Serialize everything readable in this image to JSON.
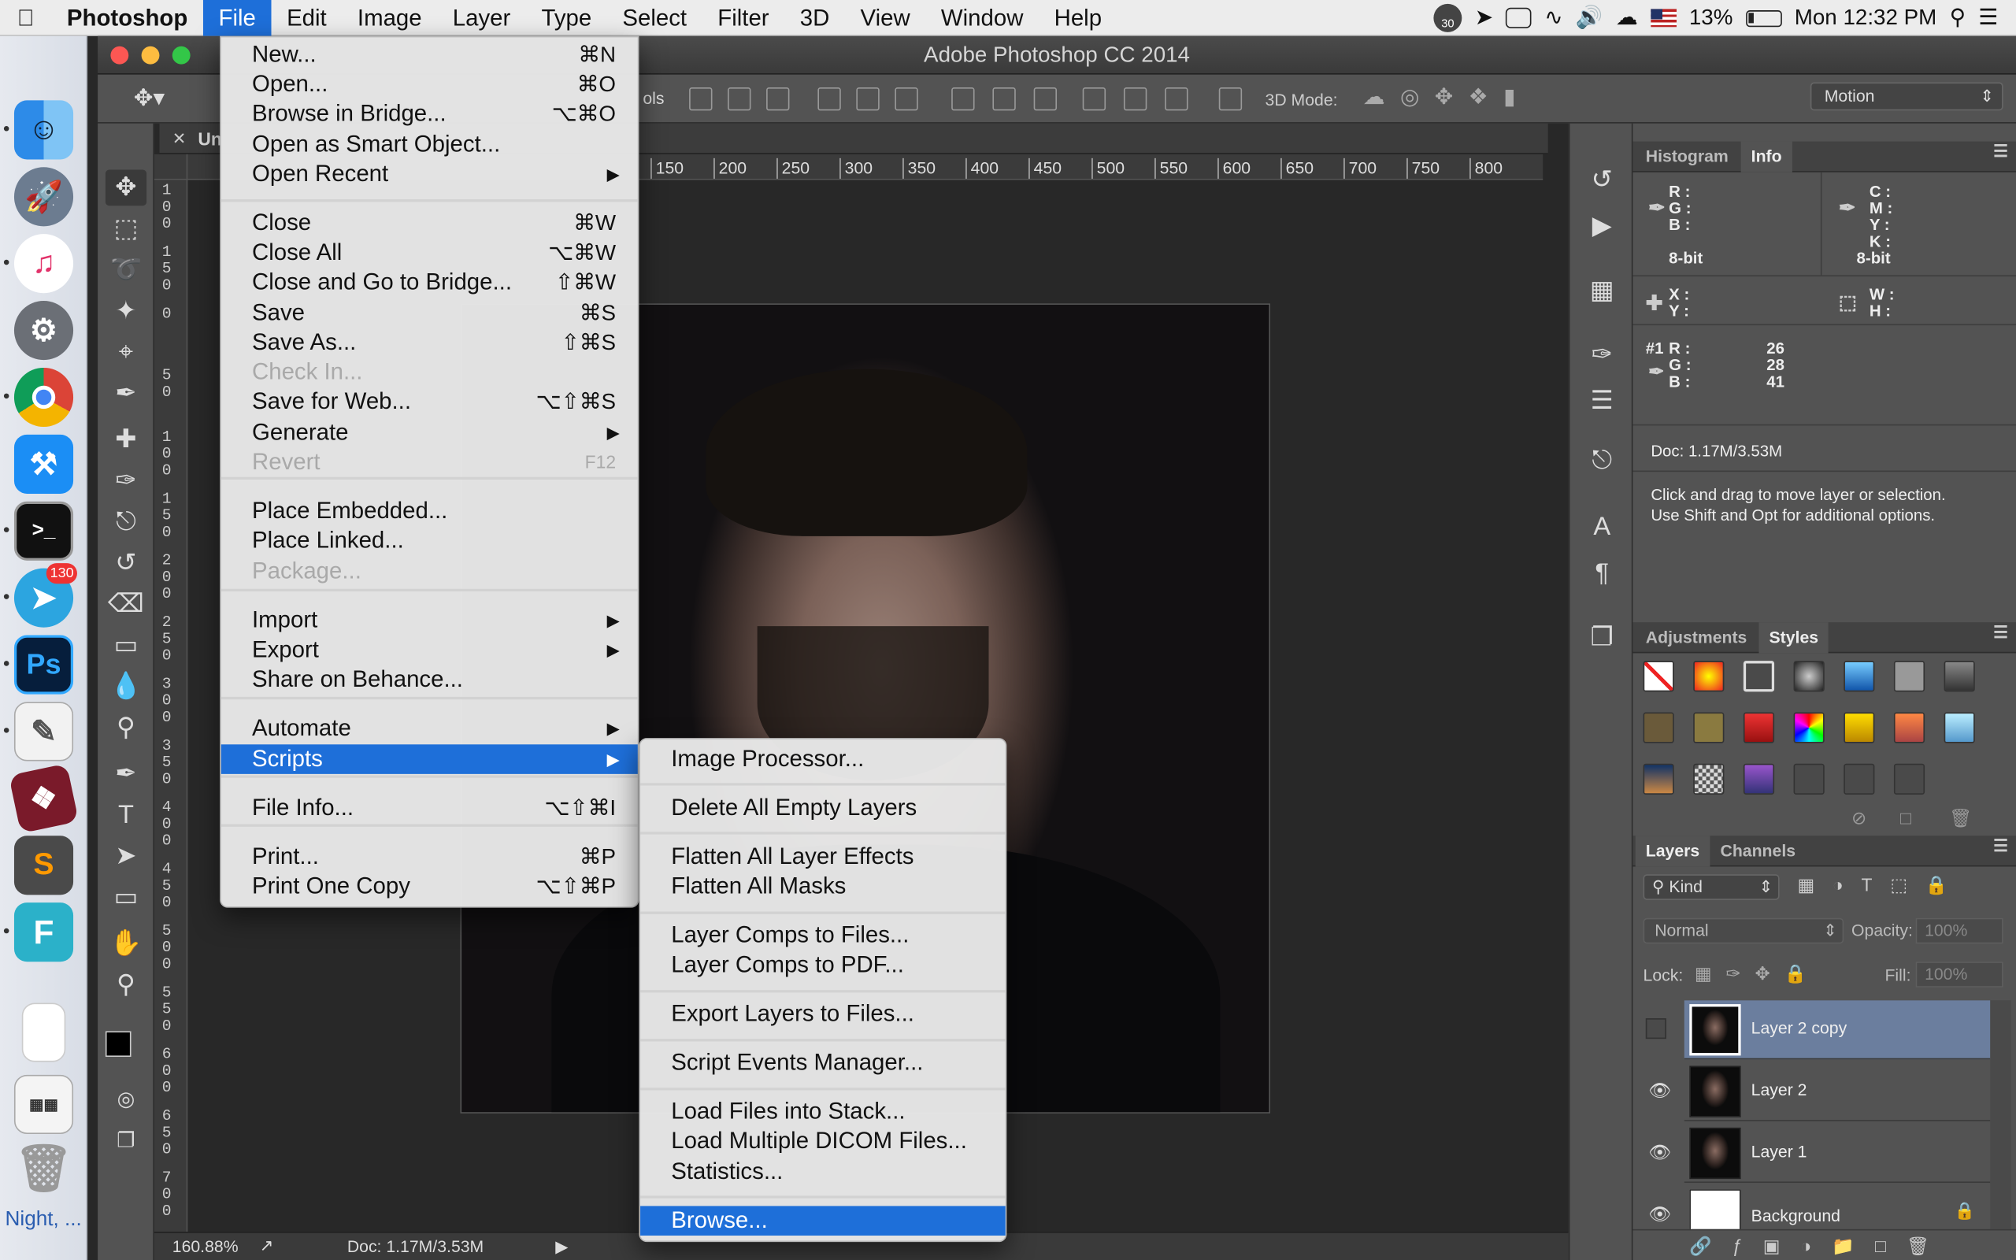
{
  "menubar": {
    "app": "Photoshop",
    "menus": [
      "File",
      "Edit",
      "Image",
      "Layer",
      "Type",
      "Select",
      "Filter",
      "3D",
      "View",
      "Window",
      "Help"
    ],
    "active_menu": "File",
    "status_badge": "30",
    "battery": "13%",
    "clock": "Mon 12:32 PM"
  },
  "dock": {
    "telegram_badge": "130",
    "bottom_label": "Night, ...",
    "apps": [
      "Finder",
      "Launchpad",
      "iTunes",
      "System Preferences",
      "Chrome",
      "Xcode",
      "Terminal",
      "Telegram",
      "Photoshop",
      "Scripteditor",
      "Typesetter",
      "Sublime Text",
      "Fontself",
      "Document",
      "Preview",
      "Trash"
    ]
  },
  "window": {
    "title": "Adobe Photoshop CC 2014",
    "doc_tab": "Un",
    "three_d_mode": "3D Mode:",
    "workspace": "Motion",
    "partial_label": "ols"
  },
  "ruler": {
    "h_ticks": [
      "150",
      "200",
      "250",
      "300",
      "350",
      "400",
      "450",
      "500",
      "550",
      "600",
      "650",
      "700",
      "750",
      "800"
    ],
    "v_ticks": [
      "100",
      "150",
      "0",
      "50",
      "100",
      "150",
      "200",
      "250",
      "300",
      "350",
      "400",
      "450",
      "500",
      "550",
      "600",
      "650",
      "700"
    ]
  },
  "statusbar": {
    "zoom": "160.88%",
    "doc": "Doc: 1.17M/3.53M"
  },
  "file_menu": {
    "items": [
      {
        "label": "New...",
        "key": "⌘N"
      },
      {
        "label": "Open...",
        "key": "⌘O"
      },
      {
        "label": "Browse in Bridge...",
        "key": "⌥⌘O"
      },
      {
        "label": "Open as Smart Object...",
        "key": ""
      },
      {
        "label": "Open Recent",
        "key": ""
      },
      {
        "label": "Close",
        "key": "⌘W"
      },
      {
        "label": "Close All",
        "key": "⌥⌘W"
      },
      {
        "label": "Close and Go to Bridge...",
        "key": "⇧⌘W"
      },
      {
        "label": "Save",
        "key": "⌘S"
      },
      {
        "label": "Save As...",
        "key": "⇧⌘S"
      },
      {
        "label": "Check In...",
        "key": ""
      },
      {
        "label": "Save for Web...",
        "key": "⌥⇧⌘S"
      },
      {
        "label": "Generate",
        "key": ""
      },
      {
        "label": "Revert",
        "key": "F12"
      },
      {
        "label": "Place Embedded...",
        "key": ""
      },
      {
        "label": "Place Linked...",
        "key": ""
      },
      {
        "label": "Package...",
        "key": ""
      },
      {
        "label": "Import",
        "key": ""
      },
      {
        "label": "Export",
        "key": ""
      },
      {
        "label": "Share on Behance...",
        "key": ""
      },
      {
        "label": "Automate",
        "key": ""
      },
      {
        "label": "Scripts",
        "key": ""
      },
      {
        "label": "File Info...",
        "key": "⌥⇧⌘I"
      },
      {
        "label": "Print...",
        "key": "⌘P"
      },
      {
        "label": "Print One Copy",
        "key": "⌥⇧⌘P"
      }
    ]
  },
  "scripts_menu": {
    "items": [
      "Image Processor...",
      "Delete All Empty Layers",
      "Flatten All Layer Effects",
      "Flatten All Masks",
      "Layer Comps to Files...",
      "Layer Comps to PDF...",
      "Export Layers to Files...",
      "Script Events Manager...",
      "Load Files into Stack...",
      "Load Multiple DICOM Files...",
      "Statistics...",
      "Browse..."
    ]
  },
  "info_panel": {
    "tabs": [
      "Histogram",
      "Info"
    ],
    "rgb_labels": [
      "R :",
      "G :",
      "B :"
    ],
    "cmyk_labels": [
      "C :",
      "M :",
      "Y :",
      "K :"
    ],
    "bit_left": "8-bit",
    "bit_right": "8-bit",
    "xy_labels": [
      "X :",
      "Y :"
    ],
    "wh_labels": [
      "W :",
      "H :"
    ],
    "sample_id": "#1",
    "sample_values": [
      "26",
      "28",
      "41"
    ],
    "doc": "Doc: 1.17M/3.53M",
    "hint1": "Click and drag to move layer or selection.",
    "hint2": "Use Shift and Opt for additional options."
  },
  "styles_panel": {
    "tabs": [
      "Adjustments",
      "Styles"
    ]
  },
  "layers_panel": {
    "tabs": [
      "Layers",
      "Channels"
    ],
    "kind": "Kind",
    "blend": "Normal",
    "opacity_label": "Opacity:",
    "opacity": "100%",
    "lock_label": "Lock:",
    "fill_label": "Fill:",
    "fill": "100%",
    "layers": [
      "Layer 2 copy",
      "Layer 2",
      "Layer 1",
      "Background"
    ]
  },
  "colors": {
    "highlight": "#1e6fd9",
    "layer_selected": "#6b7e9e"
  }
}
